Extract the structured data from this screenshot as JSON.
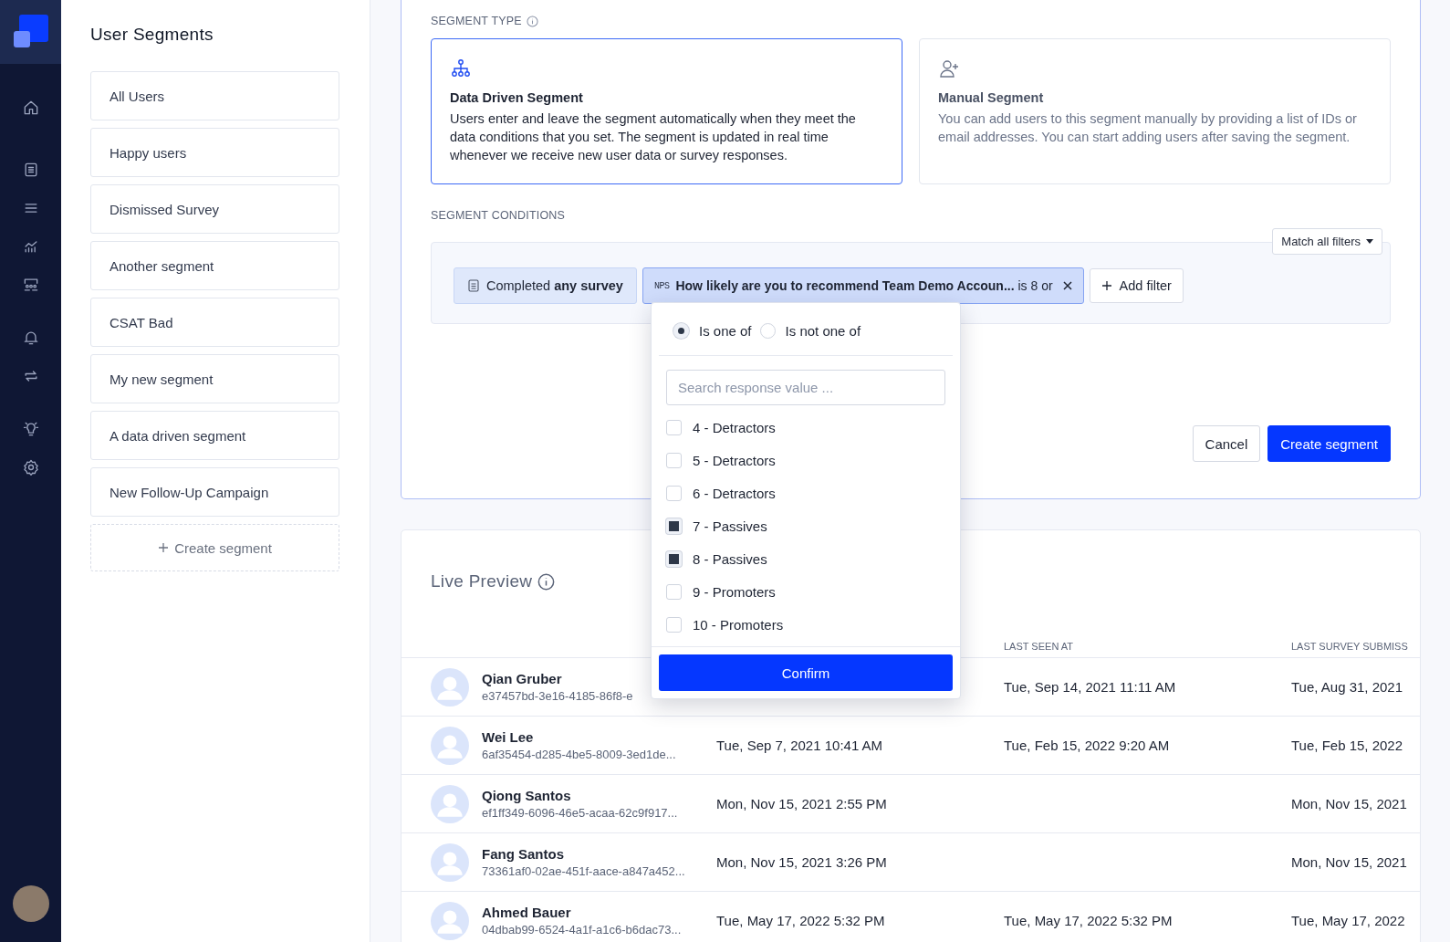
{
  "segments_panel": {
    "title": "User Segments",
    "items": [
      {
        "label": "All Users"
      },
      {
        "label": "Happy users"
      },
      {
        "label": "Dismissed Survey"
      },
      {
        "label": "Another segment"
      },
      {
        "label": "CSAT Bad"
      },
      {
        "label": "My new segment"
      },
      {
        "label": "A data driven segment"
      },
      {
        "label": "New Follow-Up Campaign"
      }
    ],
    "create_button": "Create segment"
  },
  "segment_type": {
    "label": "SEGMENT TYPE",
    "options": [
      {
        "kind": "data",
        "title": "Data Driven Segment",
        "description": "Users enter and leave the segment automatically when they meet the data conditions that you set. The segment is updated in real time whenever we receive new user data or survey responses.",
        "selected": true
      },
      {
        "kind": "manual",
        "title": "Manual Segment",
        "description": "You can add users to this segment manually by providing a list of IDs or email addresses. You can start adding users after saving the segment.",
        "selected": false
      }
    ]
  },
  "conditions": {
    "label": "SEGMENT CONDITIONS",
    "match_button": "Match all filters",
    "filters": [
      {
        "kind": "survey",
        "text": "Completed **any survey**"
      },
      {
        "kind": "nps",
        "badge": "NPS",
        "question": "How likely are you to recommend Team Demo Accoun...",
        "condition": "is 8 or"
      }
    ],
    "add_filter": "Add filter"
  },
  "actions": {
    "cancel": "Cancel",
    "create": "Create segment"
  },
  "filter_dropdown": {
    "modes": [
      {
        "label": "Is one of",
        "selected": true
      },
      {
        "label": "Is not one of",
        "selected": false
      }
    ],
    "search": {
      "placeholder": "Search response value ..."
    },
    "options": [
      {
        "label": "4 - Detractors",
        "checked": false
      },
      {
        "label": "5 - Detractors",
        "checked": false
      },
      {
        "label": "6 - Detractors",
        "checked": false
      },
      {
        "label": "7 - Passives",
        "checked": true
      },
      {
        "label": "8 - Passives",
        "checked": true
      },
      {
        "label": "9 - Promoters",
        "checked": false
      },
      {
        "label": "10 - Promoters",
        "checked": false
      }
    ],
    "confirm": "Confirm"
  },
  "live_preview": {
    "title": "Live Preview",
    "table": {
      "column_3": "LAST SEEN AT",
      "column_4": "LAST SURVEY SUBMISS",
      "rows": [
        {
          "name": "Qian Gruber",
          "id": "e37457bd-3e16-4185-86f8-e",
          "last_seen": "Tue, Sep 14, 2021 11:11 AM",
          "last_survey": "Tue, Aug 31, 2021"
        },
        {
          "name": "Wei Lee",
          "id": "6af35454-d285-4be5-8009-3ed1de...",
          "column_2": "Tue, Sep 7, 2021 10:41 AM",
          "last_seen": "Tue, Feb 15, 2022 9:20 AM",
          "last_survey": "Tue, Feb 15, 2022"
        },
        {
          "name": "Qiong Santos",
          "id": "ef1ff349-6096-46e5-acaa-62c9f917...",
          "column_2": "Mon, Nov 15, 2021 2:55 PM",
          "last_survey": "Mon, Nov 15, 2021"
        },
        {
          "name": "Fang Santos",
          "id": "73361af0-02ae-451f-aace-a847a452...",
          "column_2": "Mon, Nov 15, 2021 3:26 PM",
          "last_survey": "Mon, Nov 15, 2021"
        },
        {
          "name": "Ahmed Bauer",
          "id": "04dbab99-6524-4a1f-a1c6-b6dac73...",
          "column_2": "Tue, May 17, 2022 5:32 PM",
          "last_seen": "Tue, May 17, 2022 5:32 PM",
          "last_survey": "Tue, May 17, 2022"
        }
      ]
    }
  }
}
